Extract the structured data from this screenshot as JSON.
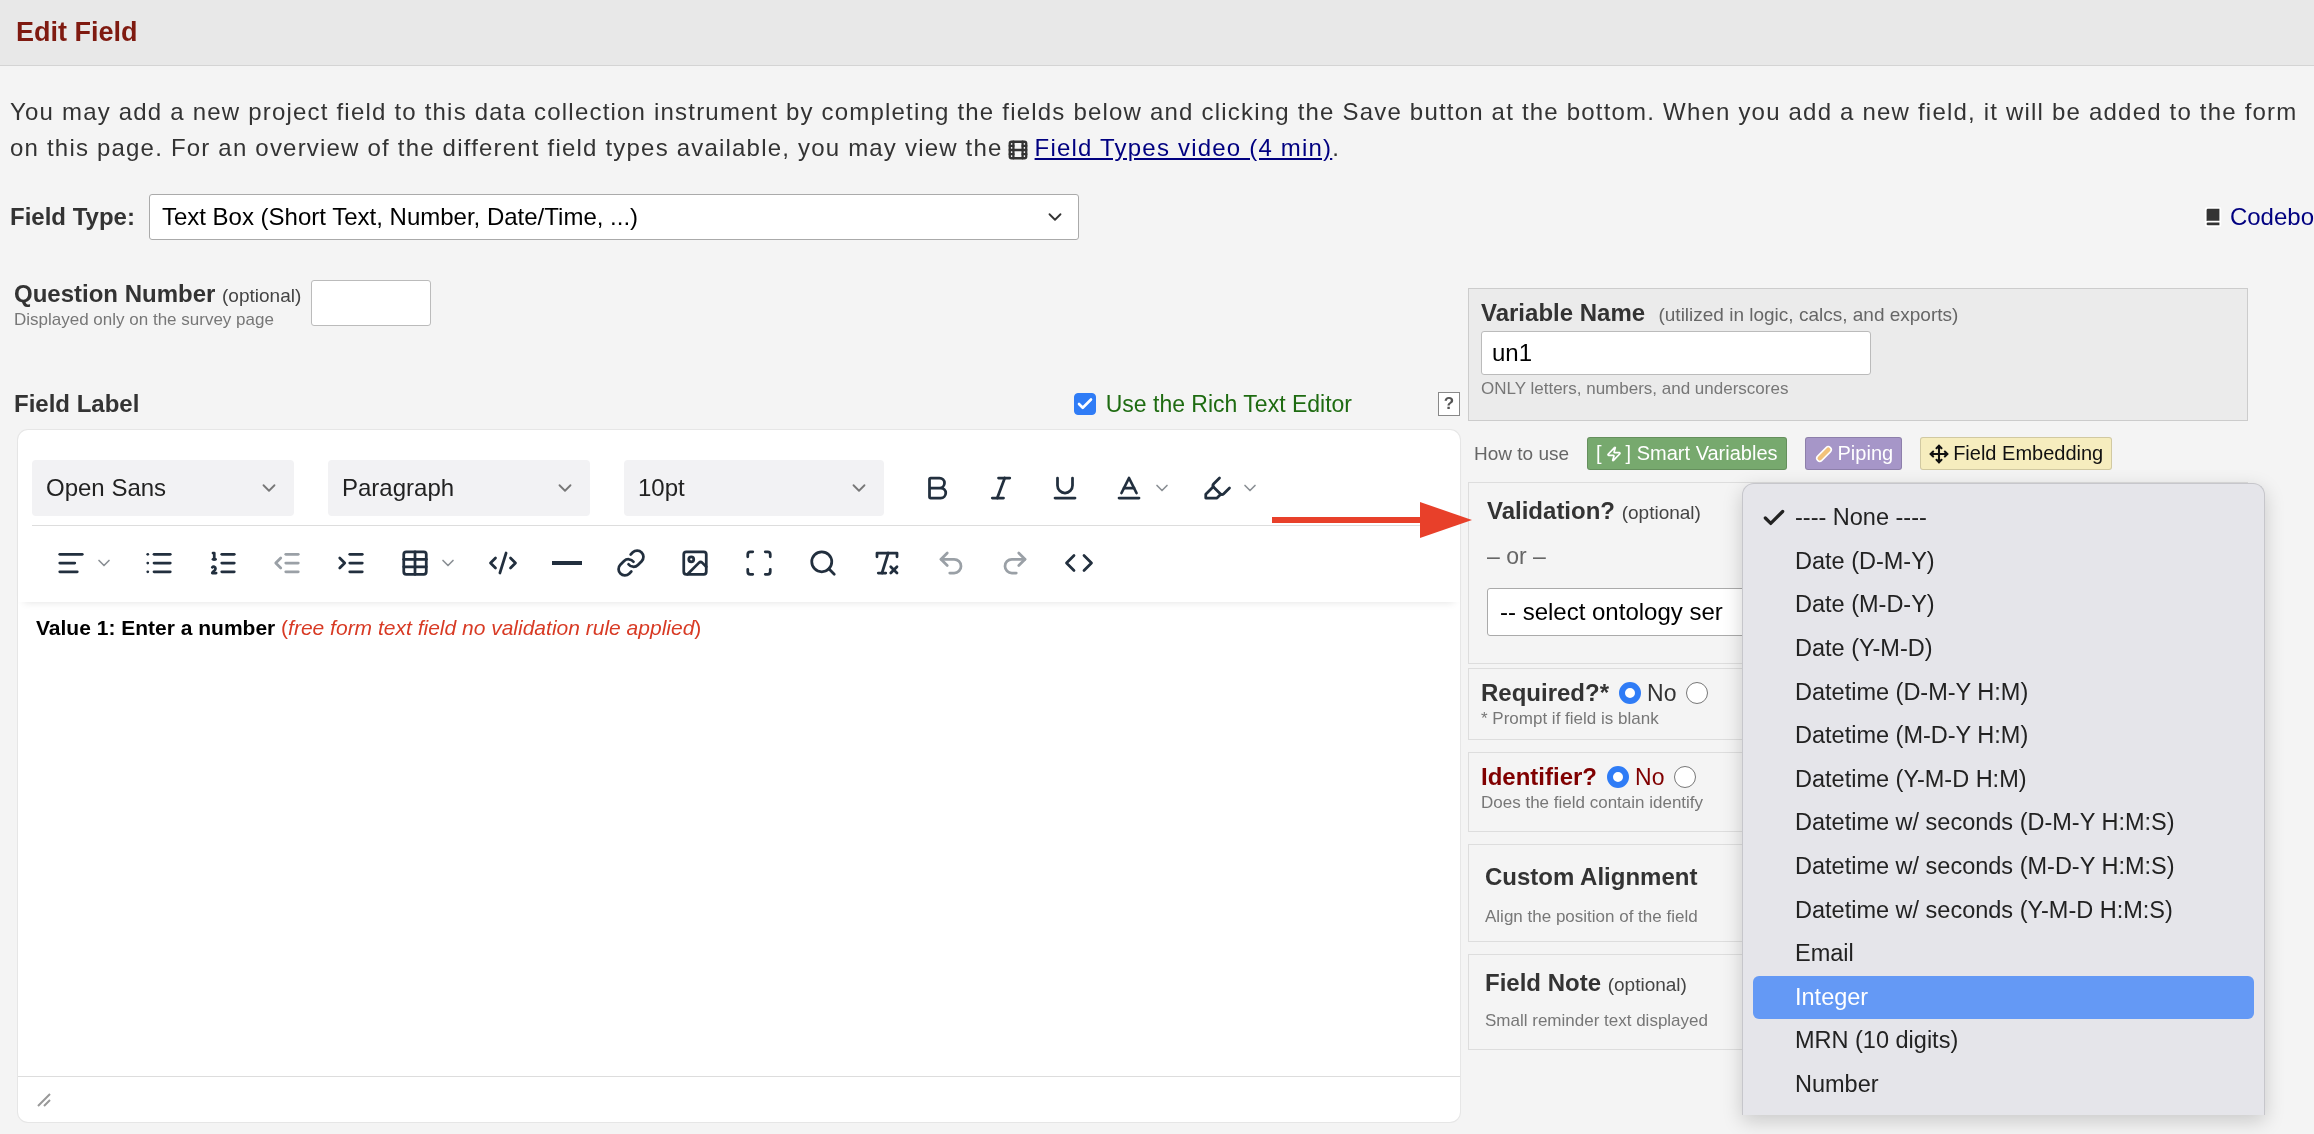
{
  "header": {
    "title": "Edit Field"
  },
  "intro": {
    "text": "You may add a new project field to this data collection instrument by completing the fields below and clicking the Save button at the bottom. When you add a new field, it will be added to the form on this page. For an overview of the different field types available, you may view the",
    "link": "Field Types video (4 min)",
    "end": "."
  },
  "field_type": {
    "label": "Field Type:",
    "value": "Text Box (Short Text, Number, Date/Time, ...)"
  },
  "codebook_link": "Codebo",
  "question_number": {
    "label": "Question Number",
    "optional": "(optional)",
    "hint": "Displayed only on the survey page"
  },
  "field_label": {
    "label": "Field Label",
    "rich_text_editor": {
      "label": "Use the Rich Text Editor",
      "checked": true
    },
    "help": "?"
  },
  "editor": {
    "font": "Open Sans",
    "block": "Paragraph",
    "size": "10pt",
    "content": {
      "label": "Value 1: Enter a number",
      "note": "(*free form text field no validation rule applied*)"
    }
  },
  "variable_name": {
    "label": "Variable Name",
    "hint": "(utilized in logic, calcs, and exports)",
    "value": "un1",
    "note": "ONLY letters, numbers, and underscores"
  },
  "how_to_use": {
    "label": "How to use",
    "badges": [
      {
        "kind": "smart",
        "open": "[",
        "close": "]",
        "label": "Smart Variables",
        "color": "#77a96e"
      },
      {
        "kind": "piping",
        "label": "Piping",
        "color": "#a696c8"
      },
      {
        "kind": "embedding",
        "label": "Field Embedding",
        "color": "#f6edbe"
      }
    ]
  },
  "validation": {
    "label": "Validation?",
    "optional": "(optional)",
    "or": "– or –",
    "ontology": "-- select ontology ser"
  },
  "required": {
    "label": "Required?*",
    "options": [
      {
        "label": "No",
        "selected": true
      },
      {
        "selected": false
      }
    ],
    "hint": "* Prompt if field is blank"
  },
  "identifier": {
    "label": "Identifier?",
    "options": [
      {
        "label": "No",
        "selected": true
      },
      {
        "selected": false
      }
    ],
    "hint": "Does the field contain identify"
  },
  "custom_alignment": {
    "label": "Custom Alignment",
    "hint": "Align the position of the field"
  },
  "field_note": {
    "label": "Field Note",
    "optional": "(optional)",
    "hint": "Small reminder text displayed"
  },
  "validation_menu": {
    "items": [
      {
        "label": "---- None ----",
        "checked": true,
        "selected": false
      },
      {
        "label": "Date (D-M-Y)",
        "checked": false,
        "selected": false
      },
      {
        "label": "Date (M-D-Y)",
        "checked": false,
        "selected": false
      },
      {
        "label": "Date (Y-M-D)",
        "checked": false,
        "selected": false
      },
      {
        "label": "Datetime (D-M-Y H:M)",
        "checked": false,
        "selected": false
      },
      {
        "label": "Datetime (M-D-Y H:M)",
        "checked": false,
        "selected": false
      },
      {
        "label": "Datetime (Y-M-D H:M)",
        "checked": false,
        "selected": false
      },
      {
        "label": "Datetime w/ seconds (D-M-Y H:M:S)",
        "checked": false,
        "selected": false
      },
      {
        "label": "Datetime w/ seconds (M-D-Y H:M:S)",
        "checked": false,
        "selected": false
      },
      {
        "label": "Datetime w/ seconds (Y-M-D H:M:S)",
        "checked": false,
        "selected": false
      },
      {
        "label": "Email",
        "checked": false,
        "selected": false
      },
      {
        "label": "Integer",
        "checked": false,
        "selected": true
      },
      {
        "label": "MRN (10 digits)",
        "checked": false,
        "selected": false
      },
      {
        "label": "Number",
        "checked": false,
        "selected": false
      }
    ]
  }
}
